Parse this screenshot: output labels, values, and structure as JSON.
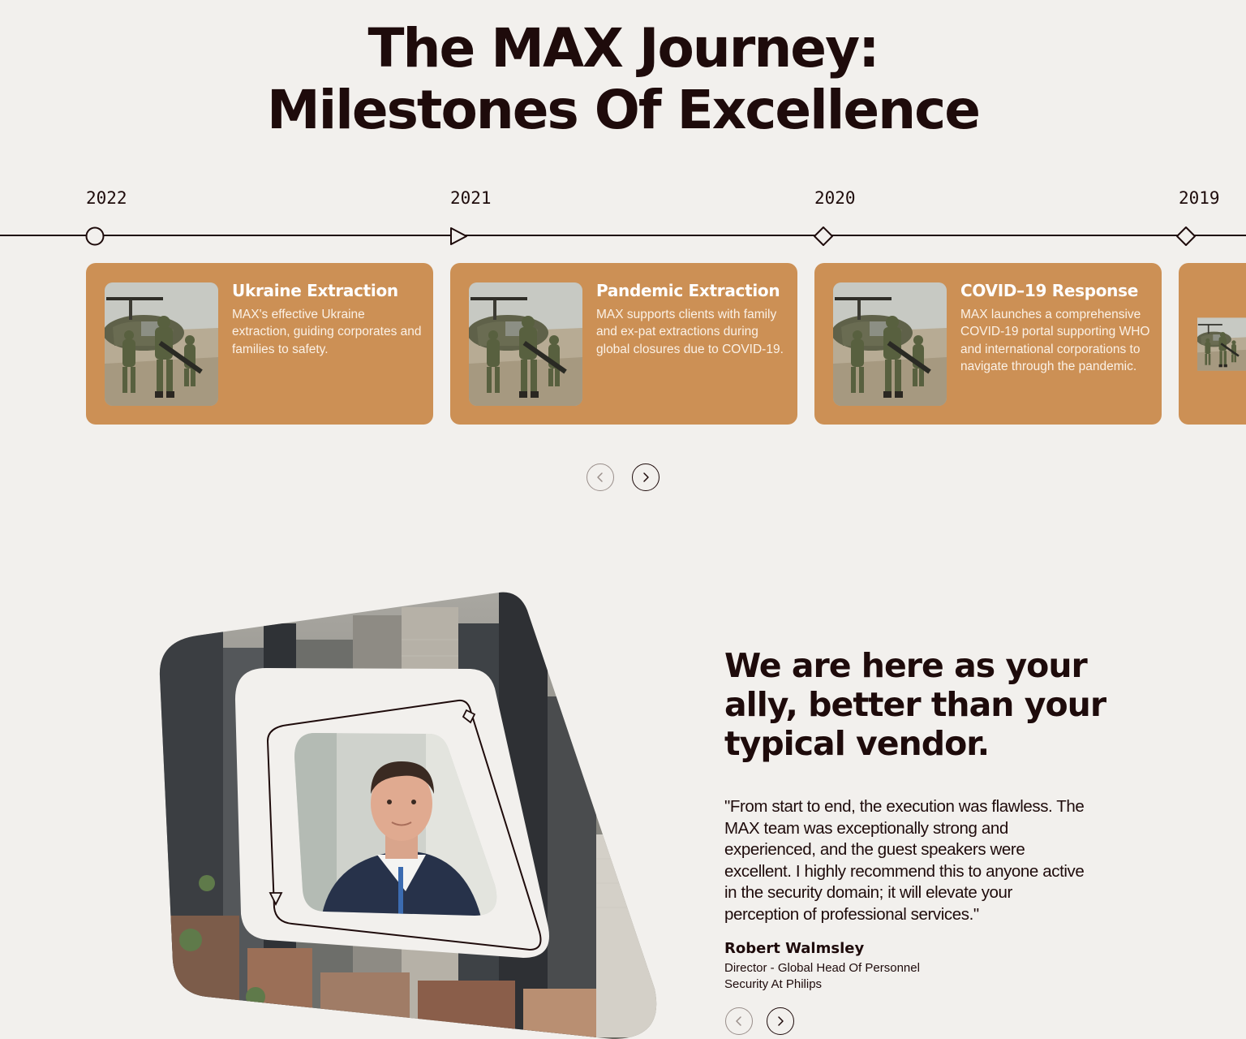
{
  "section_title": {
    "line1": "The MAX Journey:",
    "line2": "Milestones Of Excellence"
  },
  "timeline": {
    "years": [
      "2022",
      "2021",
      "2020",
      "2019"
    ],
    "milestones": [
      {
        "title": "Ukraine Extraction",
        "description": "MAX's effective Ukraine extraction, guiding corporates and families to safety."
      },
      {
        "title": "Pandemic Extraction",
        "description": "MAX supports clients with family and ex-pat extractions during global closures due to COVID-19."
      },
      {
        "title": "COVID–19 Response",
        "description": "MAX launches a comprehensive COVID-19 portal supporting WHO and international corporations to navigate through the pandemic."
      }
    ],
    "nav": {
      "prev_icon": "chevron-left-icon",
      "next_icon": "chevron-right-icon",
      "prev_enabled": false,
      "next_enabled": true
    }
  },
  "testimonial": {
    "headline": "We are here as your ally, better than your typical vendor.",
    "quote": "\"From start to end, the execution was flawless. The MAX team was exceptionally strong and experienced, and the guest speakers were excellent. I highly recommend this to anyone active in the security domain; it will elevate your perception of professional services.\"",
    "author": "Robert Walmsley",
    "role": "Director - Global Head Of Personnel Security At Philips",
    "nav": {
      "prev_icon": "chevron-left-icon",
      "next_icon": "chevron-right-icon"
    }
  },
  "colors": {
    "background": "#f2f0ed",
    "text": "#1e0b0b",
    "card": "#cc9055",
    "card_text": "#ffffff"
  }
}
